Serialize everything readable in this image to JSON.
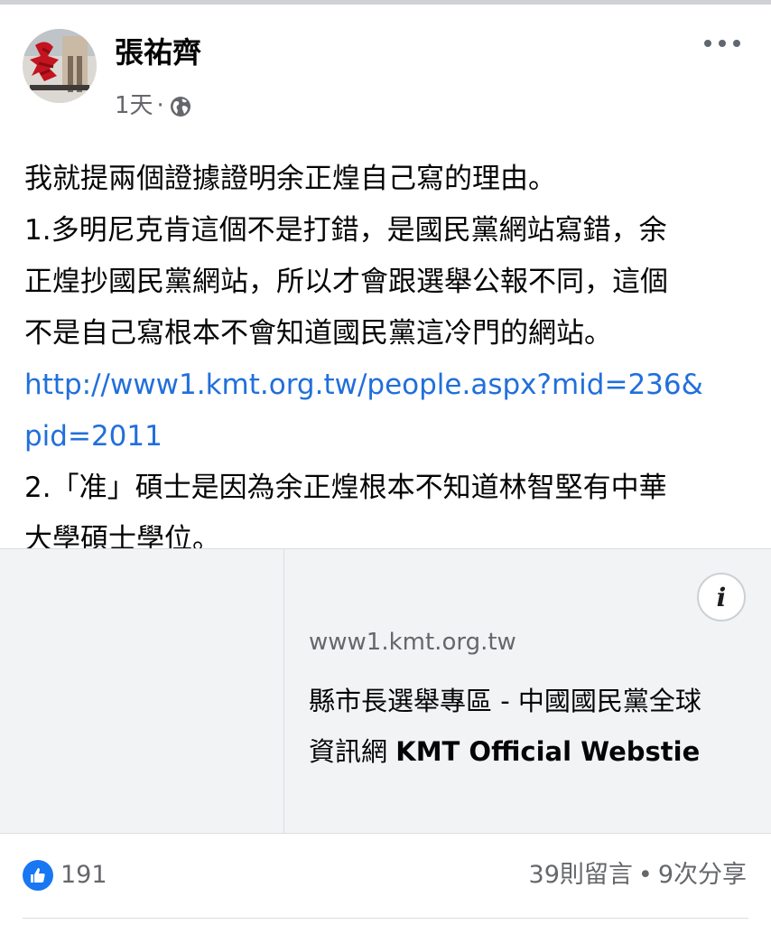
{
  "post": {
    "author": "張祐齊",
    "time": "1天",
    "meta_separator": "·",
    "privacy_icon": "globe-icon",
    "more_icon": "more-horizontal-icon",
    "text_lines": [
      "我就提兩個證據證明余正煌自己寫的理由。",
      "1.多明尼克肯這個不是打錯，是國民黨網站寫錯，余",
      "正煌抄國民黨網站，所以才會跟選舉公報不同，這個",
      "不是自己寫根本不會知道國民黨這冷門的網站。"
    ],
    "link_lines": [
      "http://www1.kmt.org.tw/people.aspx?mid=236&",
      "pid=2011"
    ],
    "text_lines_after": [
      "2.「准」碩士是因為余正煌根本不知道林智堅有中華",
      "大學碩士學位。"
    ]
  },
  "link_preview": {
    "info_icon": "info-icon",
    "info_label": "i",
    "domain": "www1.kmt.org.tw",
    "title_line1": "縣市長選舉專區 - 中國國民黨全球",
    "title_line2_prefix": "資訊網 ",
    "title_line2_bold": "KMT Official Webstie"
  },
  "footer": {
    "like_icon": "thumbs-up-icon",
    "reaction_count": "191",
    "comments": "39則留言",
    "stats_separator": "•",
    "shares": "9次分享"
  },
  "colors": {
    "link": "#216fdb",
    "like_blue": "#1877f2",
    "secondary_text": "#65676b",
    "preview_bg": "#f2f3f5"
  }
}
